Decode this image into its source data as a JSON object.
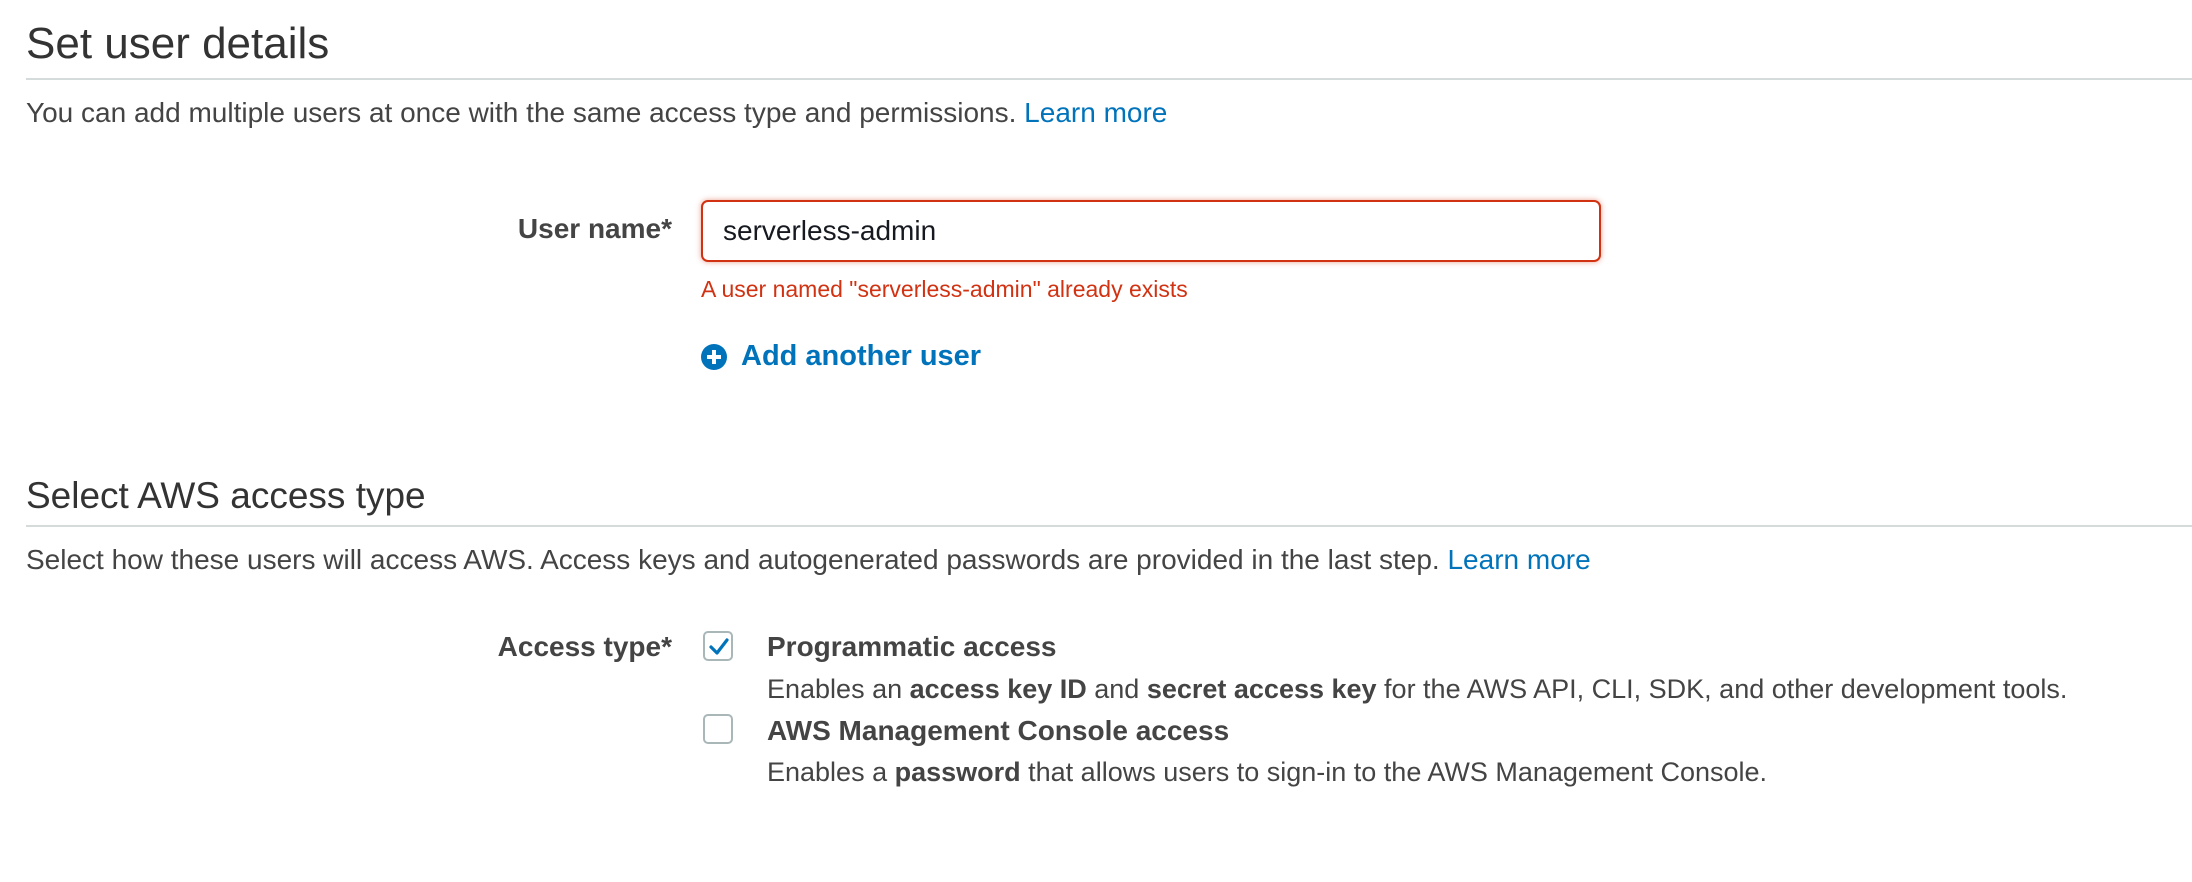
{
  "user_details": {
    "title": "Set user details",
    "description": "You can add multiple users at once with the same access type and permissions.",
    "learn_more": "Learn more",
    "user_name_label": "User name*",
    "user_name_value": "serverless-admin",
    "error_message": "A user named \"serverless-admin\" already exists",
    "add_another_user": "Add another user"
  },
  "access_type": {
    "title": "Select AWS access type",
    "description": "Select how these users will access AWS. Access keys and autogenerated passwords are provided in the last step.",
    "learn_more": "Learn more",
    "label": "Access type*",
    "options": [
      {
        "title": "Programmatic access",
        "checked": true,
        "desc_prefix": "Enables an ",
        "desc_bold_1": "access key ID",
        "desc_mid": " and ",
        "desc_bold_2": "secret access key",
        "desc_suffix": " for the AWS API, CLI, SDK, and other development tools."
      },
      {
        "title": "AWS Management Console access",
        "checked": false,
        "desc_prefix": "Enables a ",
        "desc_bold_1": "password",
        "desc_suffix": " that allows users to sign-in to the AWS Management Console."
      }
    ]
  },
  "colors": {
    "link": "#0073bb",
    "error": "#d13212",
    "text": "#444444"
  }
}
